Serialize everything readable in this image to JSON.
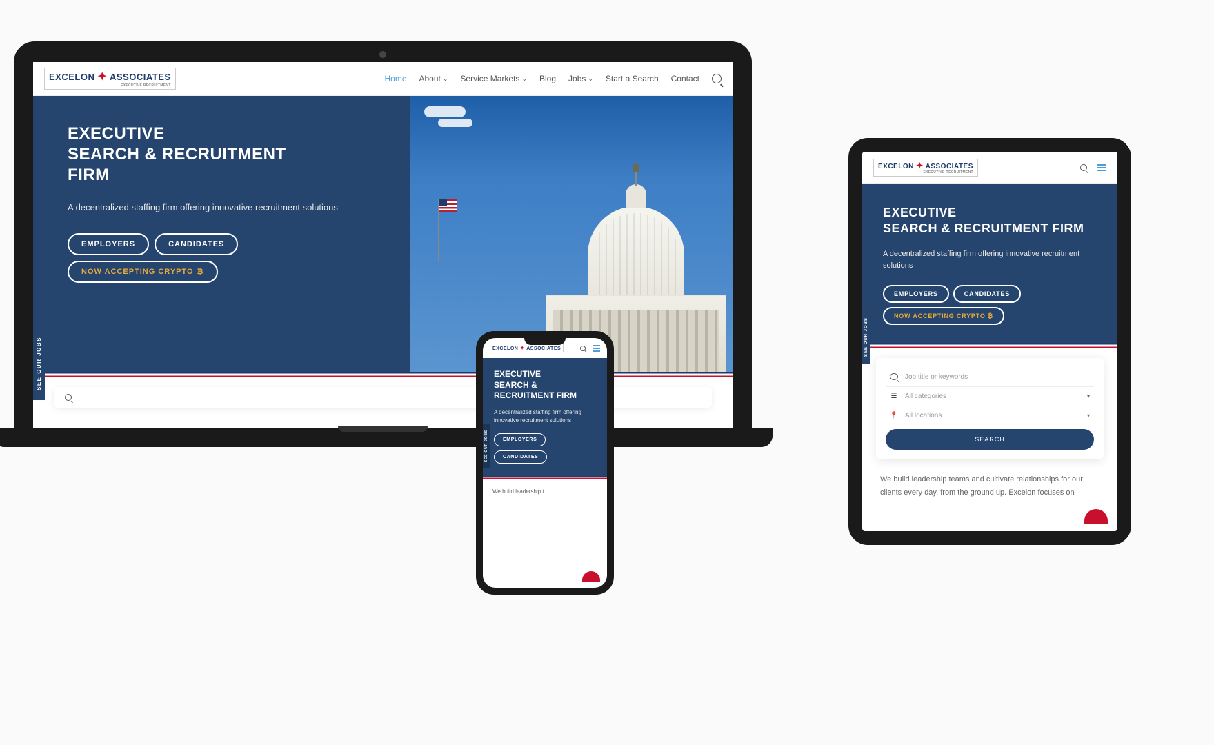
{
  "brand": {
    "left": "EXCELON",
    "right": "ASSOCIATES",
    "tagline": "EXECUTIVE RECRUITMENT"
  },
  "nav": {
    "home": "Home",
    "about": "About",
    "service_markets": "Service Markets",
    "blog": "Blog",
    "jobs": "Jobs",
    "start_search": "Start a Search",
    "contact": "Contact"
  },
  "hero": {
    "title_l1": "EXECUTIVE",
    "title_l2": "SEARCH & RECRUITMENT",
    "title_l3": "FIRM",
    "subtitle": "A decentralized staffing firm offering innovative recruitment solutions",
    "btn_employers": "EMPLOYERS",
    "btn_candidates": "CANDIDATES",
    "btn_crypto": "NOW ACCEPTING CRYPTO",
    "crypto_symbol": "₿"
  },
  "side_tab": "SEE OUR JOBS",
  "tablet": {
    "title_l1": "EXECUTIVE",
    "title_l2": "SEARCH & RECRUITMENT FIRM",
    "search": {
      "placeholder_keywords": "Job title or keywords",
      "all_categories": "All categories",
      "all_locations": "All locations",
      "button": "SEARCH"
    },
    "body": "We build leadership teams and cultivate relationships for our clients every day, from the ground up. Excelon focuses on"
  },
  "phone": {
    "title_l1": "EXECUTIVE",
    "title_l2": "SEARCH &",
    "title_l3": "RECRUITMENT FIRM",
    "body": "We build leadership t"
  },
  "colors": {
    "navy": "#25456f",
    "red": "#c8102e",
    "gold": "#e8a93c",
    "link": "#4a9fd8"
  }
}
